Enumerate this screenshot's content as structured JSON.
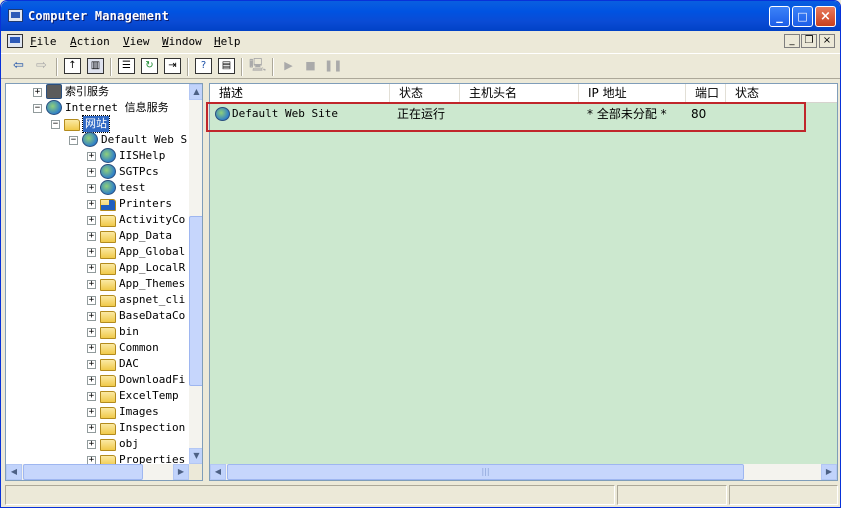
{
  "window": {
    "title": "Computer Management",
    "controls": {
      "minimize": "_",
      "maximize": "□",
      "close": "×"
    }
  },
  "menu": [
    {
      "label": "File",
      "u": "F",
      "rest": "ile"
    },
    {
      "label": "Action",
      "u": "A",
      "rest": "ction"
    },
    {
      "label": "View",
      "u": "V",
      "rest": "iew"
    },
    {
      "label": "Window",
      "u": "W",
      "rest": "indow"
    },
    {
      "label": "Help",
      "u": "H",
      "rest": "elp"
    }
  ],
  "mdi_controls": {
    "minimize": "_",
    "restore": "❐",
    "close": "×"
  },
  "toolbar_icons": [
    "back-icon",
    "forward-icon",
    "up-folder-icon",
    "show-hide-tree-icon",
    "properties-icon",
    "refresh-icon",
    "export-list-icon",
    "help-icon",
    "action-pane-icon",
    "computer-icon",
    "play-icon",
    "stop-icon",
    "pause-icon"
  ],
  "tree": [
    {
      "label": "索引服务",
      "expander": "+",
      "indent": 0,
      "icon": "index-service-icon"
    },
    {
      "label": "Internet 信息服务",
      "expander": "−",
      "indent": 0,
      "icon": "iis-icon"
    },
    {
      "label": "网站",
      "expander": "−",
      "indent": 1,
      "icon": "folder-icon",
      "selected": true
    },
    {
      "label": "Default Web S",
      "expander": "−",
      "indent": 2,
      "icon": "web-site-icon"
    },
    {
      "label": "IISHelp",
      "expander": "+",
      "indent": 3,
      "icon": "globe-icon"
    },
    {
      "label": "SGTPcs",
      "expander": "+",
      "indent": 3,
      "icon": "globe-icon"
    },
    {
      "label": "test",
      "expander": "+",
      "indent": 3,
      "icon": "globe-icon"
    },
    {
      "label": "Printers",
      "expander": "+",
      "indent": 3,
      "icon": "printers-folder-icon"
    },
    {
      "label": "ActivityCo",
      "expander": "+",
      "indent": 3,
      "icon": "folder-icon"
    },
    {
      "label": "App_Data",
      "expander": "+",
      "indent": 3,
      "icon": "folder-icon"
    },
    {
      "label": "App_Global",
      "expander": "+",
      "indent": 3,
      "icon": "folder-icon"
    },
    {
      "label": "App_LocalR",
      "expander": "+",
      "indent": 3,
      "icon": "folder-icon"
    },
    {
      "label": "App_Themes",
      "expander": "+",
      "indent": 3,
      "icon": "folder-icon"
    },
    {
      "label": "aspnet_cli",
      "expander": "+",
      "indent": 3,
      "icon": "folder-icon"
    },
    {
      "label": "BaseDataCo",
      "expander": "+",
      "indent": 3,
      "icon": "folder-icon"
    },
    {
      "label": "bin",
      "expander": "+",
      "indent": 3,
      "icon": "folder-icon"
    },
    {
      "label": "Common",
      "expander": "+",
      "indent": 3,
      "icon": "folder-icon"
    },
    {
      "label": "DAC",
      "expander": "+",
      "indent": 3,
      "icon": "folder-icon"
    },
    {
      "label": "DownloadFi",
      "expander": "+",
      "indent": 3,
      "icon": "folder-icon"
    },
    {
      "label": "ExcelTemp",
      "expander": "+",
      "indent": 3,
      "icon": "folder-icon"
    },
    {
      "label": "Images",
      "expander": "+",
      "indent": 3,
      "icon": "folder-icon"
    },
    {
      "label": "Inspection",
      "expander": "+",
      "indent": 3,
      "icon": "folder-icon"
    },
    {
      "label": "obj",
      "expander": "+",
      "indent": 3,
      "icon": "folder-icon"
    },
    {
      "label": "Properties",
      "expander": "+",
      "indent": 3,
      "icon": "folder-icon"
    }
  ],
  "list": {
    "columns": [
      "描述",
      "状态",
      "主机头名",
      "IP 地址",
      "端口",
      "状态"
    ],
    "rows": [
      {
        "description": "Default Web Site",
        "state": "正在运行",
        "host_header": "",
        "ip": "* 全部未分配 *",
        "port": "80",
        "status": ""
      }
    ]
  },
  "colors": {
    "list_background": "#cce8cf",
    "selection": "#316ac5",
    "highlight_box": "#c0262b"
  }
}
